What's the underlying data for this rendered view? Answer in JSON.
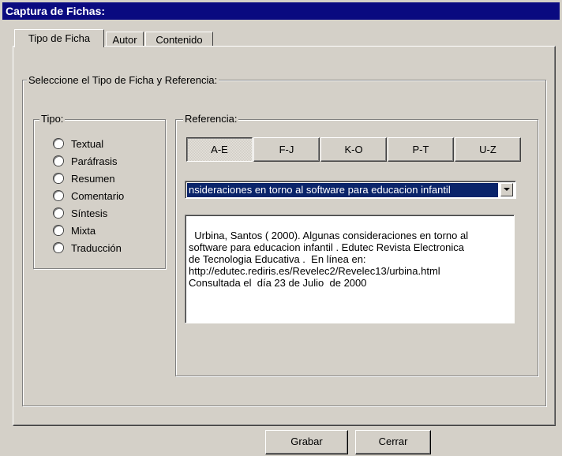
{
  "window": {
    "title": "Captura de Fichas:"
  },
  "tabs": [
    {
      "label": "Tipo de Ficha",
      "active": true
    },
    {
      "label": "Autor",
      "active": false
    },
    {
      "label": "Contenido",
      "active": false
    }
  ],
  "main_group": {
    "label": "Seleccione el Tipo de Ficha y Referencia:"
  },
  "tipo_group": {
    "label": "Tipo:",
    "options": [
      "Textual",
      "Paráfrasis",
      "Resumen",
      "Comentario",
      "Síntesis",
      "Mixta",
      "Traducción"
    ],
    "selected": null
  },
  "referencia_group": {
    "label": "Referencia:",
    "letter_buttons": [
      "A-E",
      "F-J",
      "K-O",
      "P-T",
      "U-Z"
    ],
    "active_letter": "A-E",
    "combo_selected": "nsideraciones en torno al software para educacion infantil",
    "reference_text": "Urbina, Santos ( 2000). Algunas consideraciones en torno al\nsoftware para educacion infantil . Edutec Revista Electronica\nde Tecnologia Educativa .  En línea en:\nhttp://edutec.rediris.es/Revelec2/Revelec13/urbina.html\nConsultada el  día 23 de Julio  de 2000"
  },
  "footer": {
    "save_label": "Grabar",
    "close_label": "Cerrar"
  },
  "colors": {
    "title_bg": "#0a0a80",
    "face": "#d4d0c8",
    "selection": "#0a246a"
  },
  "icons": {
    "combo_arrow": "chevron-down-icon"
  }
}
